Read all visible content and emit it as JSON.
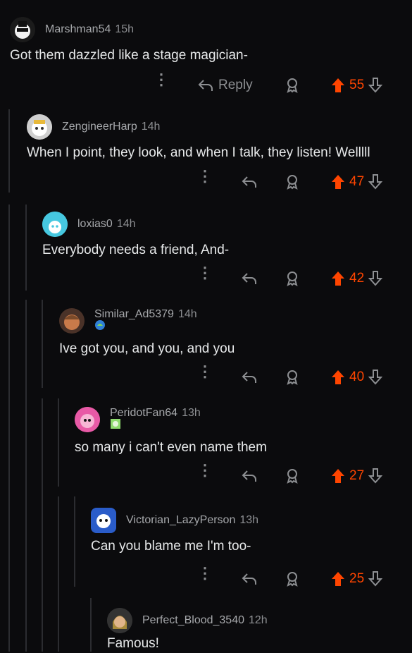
{
  "comments": [
    {
      "username": "Marshman54",
      "time": "15h",
      "text": "Got them dazzled like a stage magician-",
      "votes": "55",
      "reply_label": "Reply"
    },
    {
      "username": "ZengineerHarp",
      "time": "14h",
      "text": "When I point, they look, and when I talk, they listen! Welllll",
      "votes": "47"
    },
    {
      "username": "loxias0",
      "time": "14h",
      "text": "Everybody needs a friend, And-",
      "votes": "42"
    },
    {
      "username": "Similar_Ad5379",
      "time": "14h",
      "text": "Ive got you, and you, and you",
      "votes": "40"
    },
    {
      "username": "PeridotFan64",
      "time": "13h",
      "text": "so many i can't even name them",
      "votes": "27"
    },
    {
      "username": "Victorian_LazyPerson",
      "time": "13h",
      "text": "Can you blame me I'm too-",
      "votes": "25"
    },
    {
      "username": "Perfect_Blood_3540",
      "time": "12h",
      "text": "Famous!",
      "votes": ""
    }
  ],
  "icons": {
    "more": "more-options-icon",
    "reply": "reply-arrow-icon",
    "award": "award-icon",
    "upvote": "upvote-arrow-icon",
    "downvote": "downvote-arrow-icon"
  },
  "colors": {
    "upvote": "#ff4500",
    "background": "#0b0b0d",
    "thread_line": "#2b2c30"
  }
}
